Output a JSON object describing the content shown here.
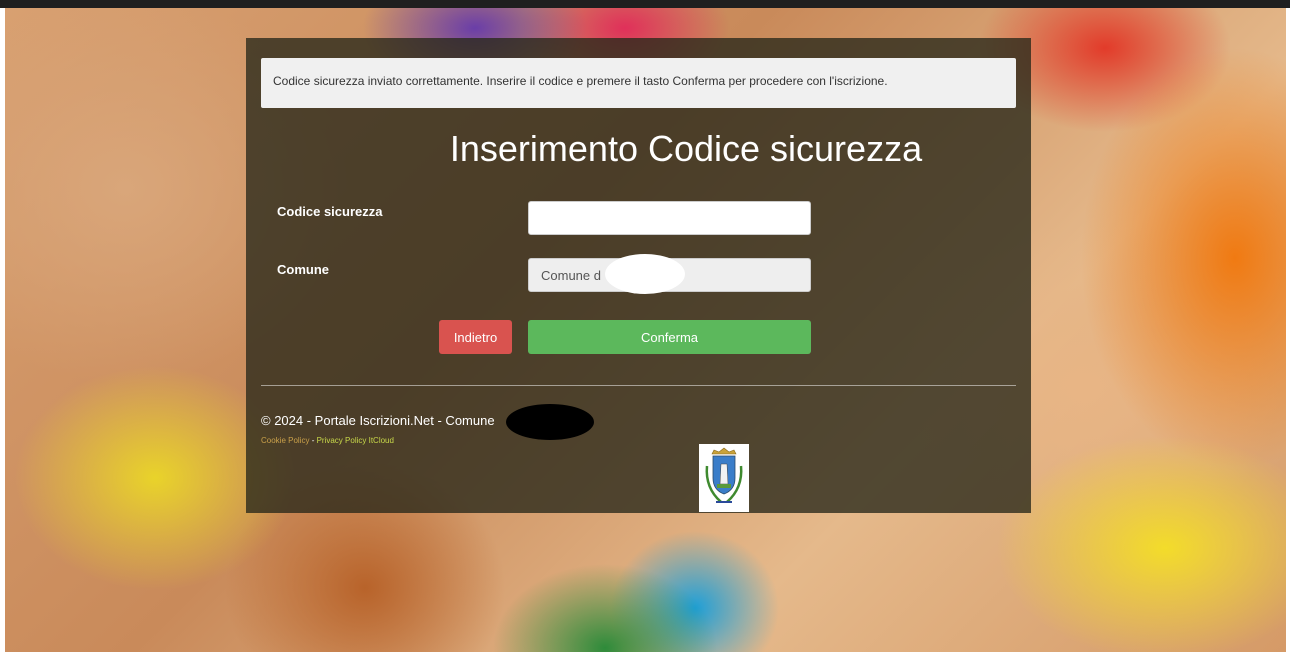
{
  "alert": {
    "message": "Codice sicurezza inviato correttamente. Inserire il codice e premere il tasto Conferma per procedere con l'iscrizione."
  },
  "page": {
    "title": "Inserimento Codice sicurezza"
  },
  "form": {
    "code_label": "Codice sicurezza",
    "code_value": "",
    "comune_label": "Comune",
    "comune_value": "Comune d"
  },
  "buttons": {
    "back_label": "Indietro",
    "confirm_label": "Conferma"
  },
  "footer": {
    "copyright": "© 2024 - Portale Iscrizioni.Net - Comune",
    "cookie_link": "Cookie Policy",
    "separator": " - ",
    "privacy_link": "Privacy Policy ItCloud"
  },
  "colors": {
    "back_button": "#d9534f",
    "confirm_button": "#5cb85c",
    "panel": "rgba(40,40,25,0.78)"
  },
  "icons": {
    "crest": "municipal-crest-icon"
  }
}
